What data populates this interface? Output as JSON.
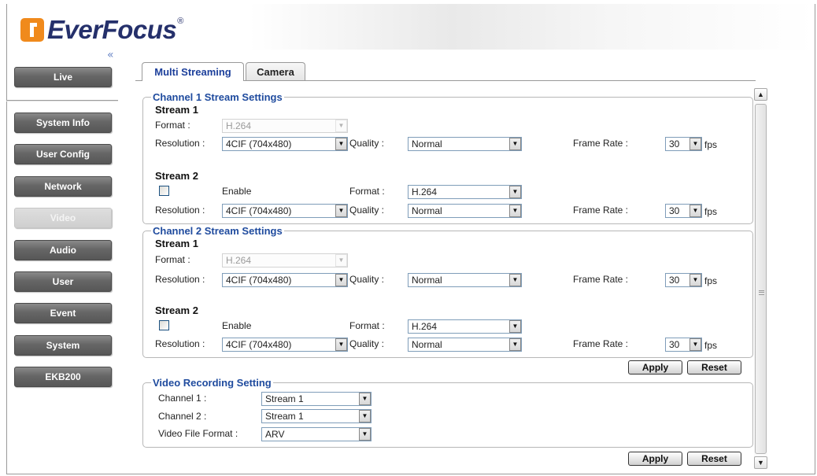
{
  "brand": {
    "name": "EverFocus",
    "registered": "®"
  },
  "sidebar": {
    "collapse_glyph": "«",
    "items": [
      {
        "label": "Live"
      },
      {
        "label": "System Info"
      },
      {
        "label": "User Config"
      },
      {
        "label": "Network"
      },
      {
        "label": "Video"
      },
      {
        "label": "Audio"
      },
      {
        "label": "User"
      },
      {
        "label": "Event"
      },
      {
        "label": "System"
      },
      {
        "label": "EKB200"
      }
    ],
    "active": "Video"
  },
  "tabs": [
    {
      "label": "Multi Streaming",
      "selected": true
    },
    {
      "label": "Camera",
      "selected": false
    }
  ],
  "labels": {
    "stream1": "Stream 1",
    "stream2": "Stream 2",
    "format": "Format :",
    "format2": "Format :",
    "resolution": "Resolution :",
    "quality": "Quality :",
    "frame_rate": "Frame Rate :",
    "fps": "fps",
    "enable": "Enable"
  },
  "channels": [
    {
      "title": "Channel 1 Stream Settings",
      "stream1": {
        "format": "H.264",
        "resolution": "4CIF (704x480)",
        "quality": "Normal",
        "frame_rate": "30"
      },
      "stream2": {
        "enabled": false,
        "format": "H.264",
        "resolution": "4CIF (704x480)",
        "quality": "Normal",
        "frame_rate": "30"
      }
    },
    {
      "title": "Channel 2 Stream Settings",
      "stream1": {
        "format": "H.264",
        "resolution": "4CIF (704x480)",
        "quality": "Normal",
        "frame_rate": "30"
      },
      "stream2": {
        "enabled": false,
        "format": "H.264",
        "resolution": "4CIF (704x480)",
        "quality": "Normal",
        "frame_rate": "30"
      }
    }
  ],
  "buttons": {
    "apply": "Apply",
    "reset": "Reset"
  },
  "recording": {
    "title": "Video Recording Setting",
    "channel1_label": "Channel 1 :",
    "channel1_value": "Stream 1",
    "channel2_label": "Channel 2 :",
    "channel2_value": "Stream 1",
    "file_format_label": "Video File Format :",
    "file_format_value": "ARV"
  },
  "icons": {
    "dropdown": "chevron-down-icon",
    "scroll_up": "scroll-up-icon",
    "scroll_down": "scroll-down-icon"
  },
  "colors": {
    "accent": "#1f4b9e",
    "logo_orange": "#f08a1c",
    "logo_navy": "#25306b"
  }
}
